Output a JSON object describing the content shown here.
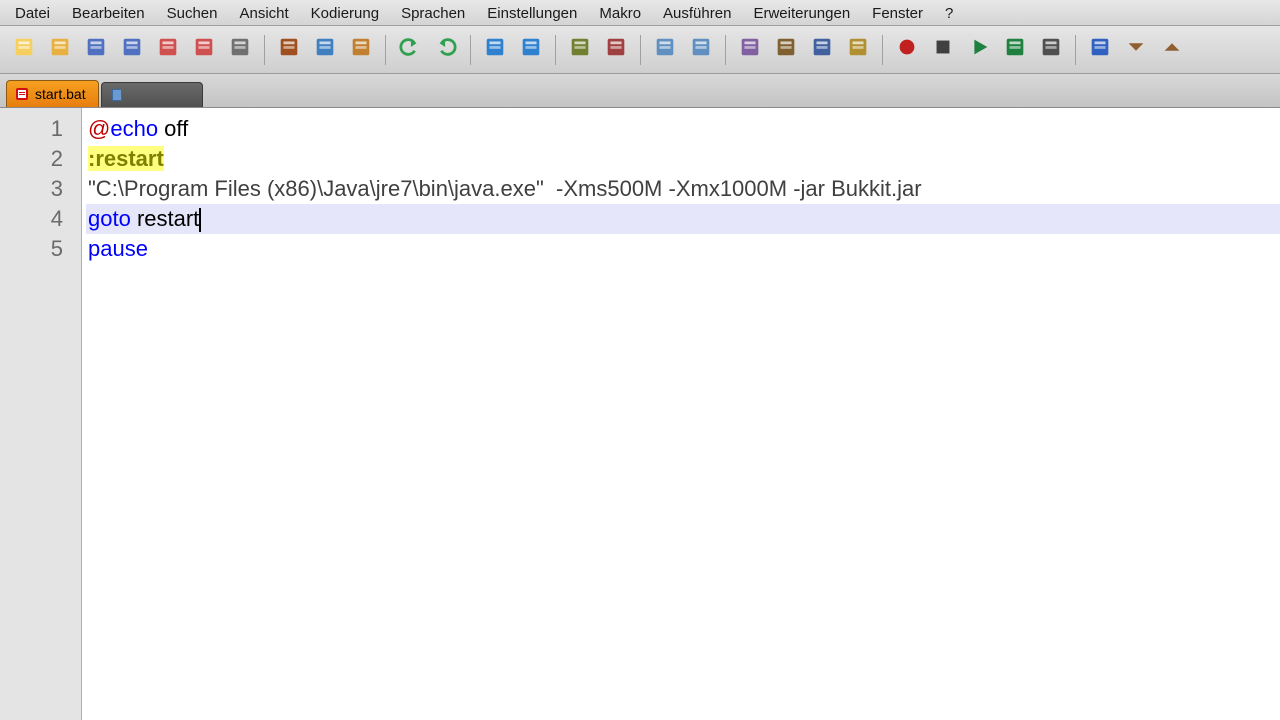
{
  "menu": {
    "items": [
      "Datei",
      "Bearbeiten",
      "Suchen",
      "Ansicht",
      "Kodierung",
      "Sprachen",
      "Einstellungen",
      "Makro",
      "Ausführen",
      "Erweiterungen",
      "Fenster",
      "?"
    ]
  },
  "toolbar": {
    "icons": [
      "new-file",
      "open-file",
      "save",
      "save-all",
      "close-file",
      "close-all",
      "print",
      "|",
      "cut",
      "copy",
      "paste",
      "|",
      "undo",
      "redo",
      "|",
      "find",
      "replace",
      "|",
      "zoom-in",
      "zoom-out",
      "|",
      "sync-v",
      "sync-h",
      "|",
      "wrap",
      "show-all",
      "indent-guide",
      "doc-map",
      "|",
      "record",
      "stop",
      "play",
      "play-multi",
      "toggle",
      "|",
      "func-list",
      "fold-all",
      "unfold-all"
    ]
  },
  "tabs": {
    "active": {
      "name": "start.bat",
      "modified": true
    },
    "inactive": {
      "name": ""
    }
  },
  "code": {
    "lines": [
      {
        "n": 1,
        "tokens": [
          {
            "t": "@",
            "c": "at"
          },
          {
            "t": "echo ",
            "c": "kw"
          },
          {
            "t": "off",
            "c": "id"
          }
        ]
      },
      {
        "n": 2,
        "tokens": [
          {
            "t": ":restart",
            "c": "lbl"
          }
        ]
      },
      {
        "n": 3,
        "tokens": [
          {
            "t": "\"C:\\Program Files (x86)\\Java\\jre7\\bin\\java.exe\"",
            "c": "str"
          },
          {
            "t": "  -Xms500M -Xmx1000M -jar Bukkit.jar",
            "c": "arg"
          }
        ]
      },
      {
        "n": 4,
        "current": true,
        "tokens": [
          {
            "t": "goto ",
            "c": "kw"
          },
          {
            "t": "restart",
            "c": "id"
          }
        ]
      },
      {
        "n": 5,
        "tokens": [
          {
            "t": "pause",
            "c": "kw"
          }
        ]
      }
    ]
  }
}
